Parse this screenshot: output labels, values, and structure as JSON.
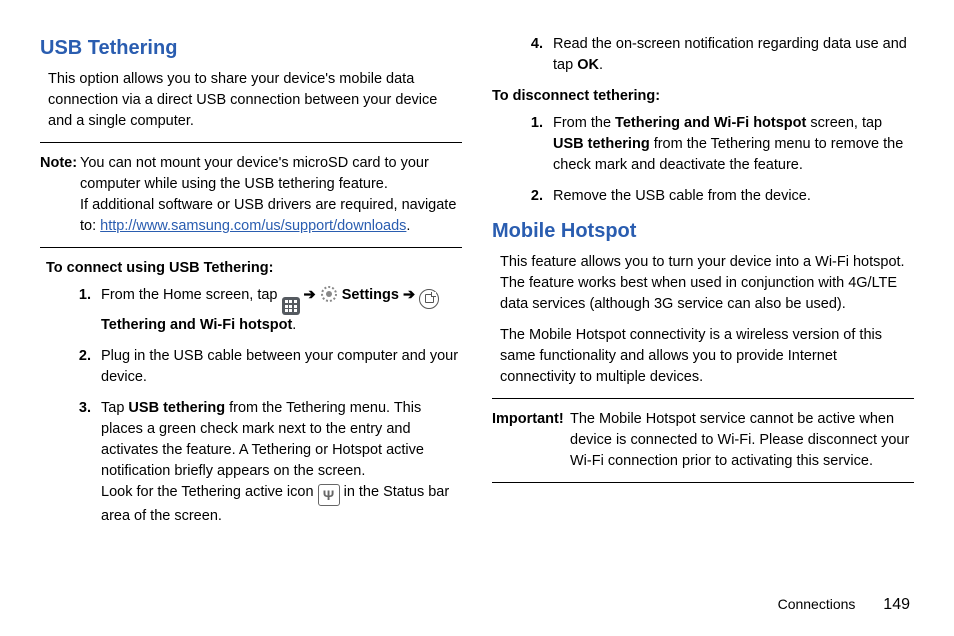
{
  "col1": {
    "h_usb": "USB Tethering",
    "intro_usb": "This option allows you to share your device's mobile data connection via a direct USB connection between your device and a single computer.",
    "note_label": "Note:",
    "note_p1": "You can not mount your device's microSD card to your computer while using the USB tethering feature.",
    "note_p2a": "If additional software or USB drivers are required, navigate to: ",
    "note_link": "http://www.samsung.com/us/support/downloads",
    "note_p2b": ".",
    "sub_connect": "To connect using USB Tethering:",
    "s1a": "From the Home screen, tap ",
    "s1b": " Settings ",
    "s1c": " Tethering and Wi-Fi hotspot",
    "s1d": ".",
    "s2": "Plug in the USB cable between your computer and your device.",
    "s3a": "Tap ",
    "s3b": "USB tethering",
    "s3c": " from the Tethering menu. This places a green check mark next to the entry and activates the feature. A Tethering or Hotspot active notification briefly appears on the screen.",
    "s3d": "Look for the Tethering active icon ",
    "s3e": " in the Status bar area of the screen.",
    "arrow": "➔"
  },
  "col2": {
    "s4a": "Read the on-screen notification regarding data use and tap ",
    "s4b": "OK",
    "s4c": ".",
    "sub_disc": "To disconnect tethering:",
    "d1a": "From the ",
    "d1b": "Tethering and Wi-Fi hotspot",
    "d1c": " screen, tap ",
    "d1d": "USB tethering",
    "d1e": " from the Tethering menu to remove the check mark and deactivate the feature.",
    "d2": "Remove the USB cable from the device.",
    "h_hotspot": "Mobile Hotspot",
    "hs_p1": "This feature allows you to turn your device into a Wi-Fi hotspot. The feature works best when used in conjunction with 4G/LTE data services (although 3G service can also be used).",
    "hs_p2": "The Mobile Hotspot connectivity is a wireless version of this same functionality and allows you to provide Internet connectivity to multiple devices.",
    "imp_label": "Important!",
    "imp_body": "The Mobile Hotspot service cannot be active when device is connected to Wi-Fi. Please disconnect your Wi-Fi connection prior to activating this service."
  },
  "footer": {
    "section": "Connections",
    "page": "149"
  }
}
